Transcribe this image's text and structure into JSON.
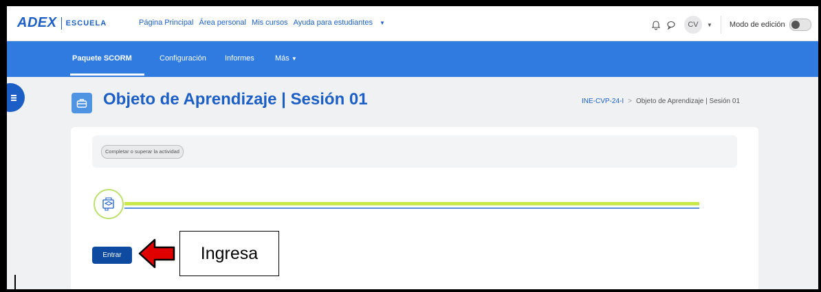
{
  "header": {
    "logo_main": "ADEX",
    "logo_sub": "ESCUELA",
    "nav": [
      {
        "label": "Página Principal"
      },
      {
        "label": "Área personal"
      },
      {
        "label": "Mis cursos"
      },
      {
        "label": "Ayuda para estudiantes"
      }
    ],
    "icons": [
      "bell-icon",
      "chat-icon"
    ],
    "user_initials": "CV",
    "edit_mode_label": "Modo de edición",
    "edit_mode_on": false
  },
  "secondary_nav": {
    "items": [
      {
        "label": "Paquete SCORM",
        "active": true
      },
      {
        "label": "Configuración",
        "active": false
      },
      {
        "label": "Informes",
        "active": false
      },
      {
        "label": "Más",
        "active": false
      }
    ]
  },
  "page": {
    "title": "Objeto de Aprendizaje | Sesión 01",
    "breadcrumb": [
      {
        "label": "INE-CVP-24-I"
      },
      {
        "label": "Objeto de Aprendizaje | Sesión 01"
      }
    ]
  },
  "activity": {
    "completion_label": "Completar o superar la actividad",
    "enter_label": "Entrar"
  },
  "annotation": {
    "callout_text": "Ingresa"
  },
  "colors": {
    "brand": "#1b5fc6",
    "subnav": "#2f7be0",
    "button": "#0d4aa0",
    "arrow": "#e00000",
    "progress_green": "#c9e84a"
  }
}
